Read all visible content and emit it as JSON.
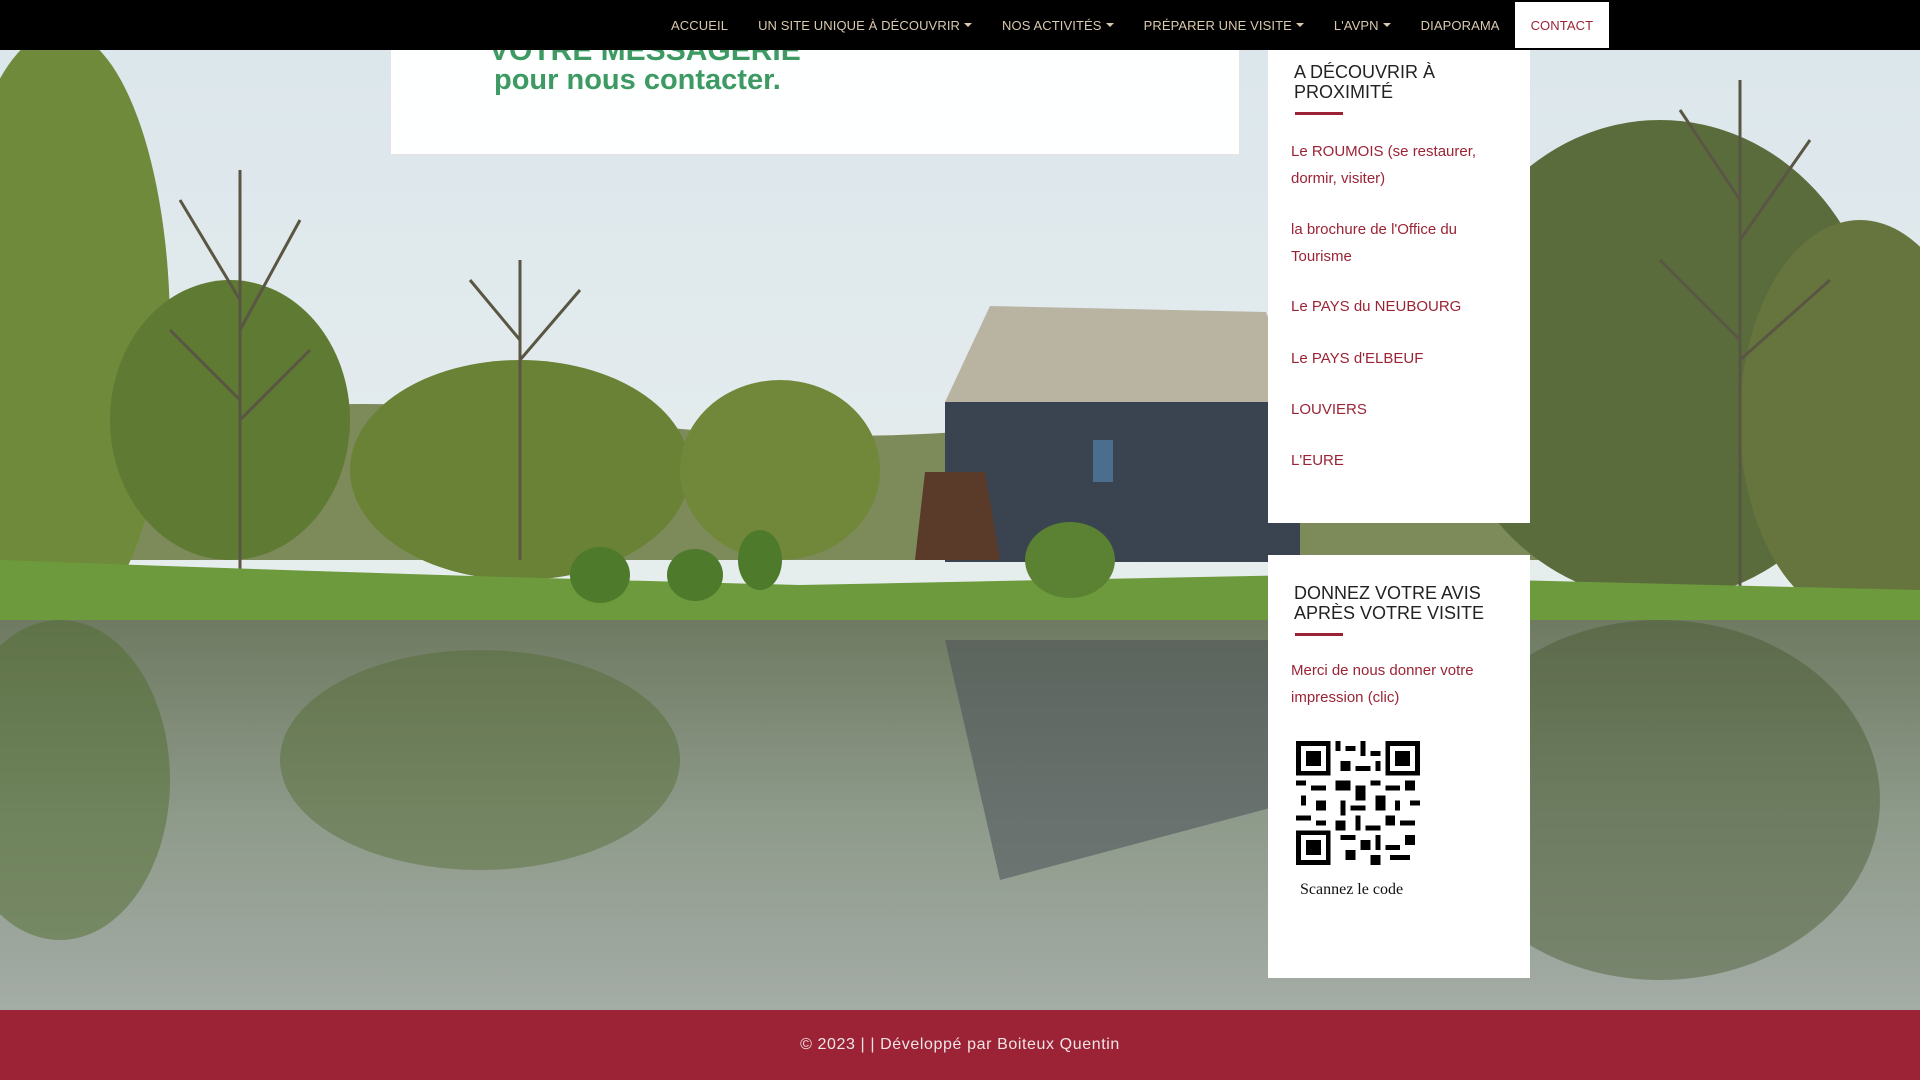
{
  "nav": {
    "items": [
      {
        "label": "ACCUEIL",
        "dropdown": false,
        "active": false
      },
      {
        "label": "UN SITE UNIQUE À DÉCOUVRIR",
        "dropdown": true,
        "active": false
      },
      {
        "label": "NOS ACTIVITÉS",
        "dropdown": true,
        "active": false
      },
      {
        "label": "PRÉPARER UNE VISITE",
        "dropdown": true,
        "active": false
      },
      {
        "label": "L'AVPN",
        "dropdown": true,
        "active": false
      },
      {
        "label": "DIAPORAMA",
        "dropdown": false,
        "active": false
      },
      {
        "label": "CONTACT",
        "dropdown": false,
        "active": true
      }
    ]
  },
  "content": {
    "title_line1": "VOTRE MESSAGERIE",
    "title_line2": "pour nous contacter."
  },
  "widget_nearby": {
    "title": "A DÉCOUVRIR À PROXIMITÉ",
    "links": [
      "Le ROUMOIS (se restaurer, dormir, visiter)",
      " la brochure de l'Office du Tourisme",
      "Le PAYS du NEUBOURG",
      "Le PAYS d'ELBEUF",
      "LOUVIERS",
      "L'EURE"
    ]
  },
  "widget_review": {
    "title": "DONNEZ VOTRE AVIS APRÈS VOTRE VISITE",
    "link": "Merci de nous donner votre impression (clic)",
    "qr_caption": "Scannez le code"
  },
  "footer": {
    "text": "© 2023 | | Développé par Boiteux Quentin"
  },
  "colors": {
    "accent": "#9b2335",
    "title_green": "#3c9a62",
    "nav_bg": "#000000",
    "nav_text": "#d9c9b0"
  }
}
